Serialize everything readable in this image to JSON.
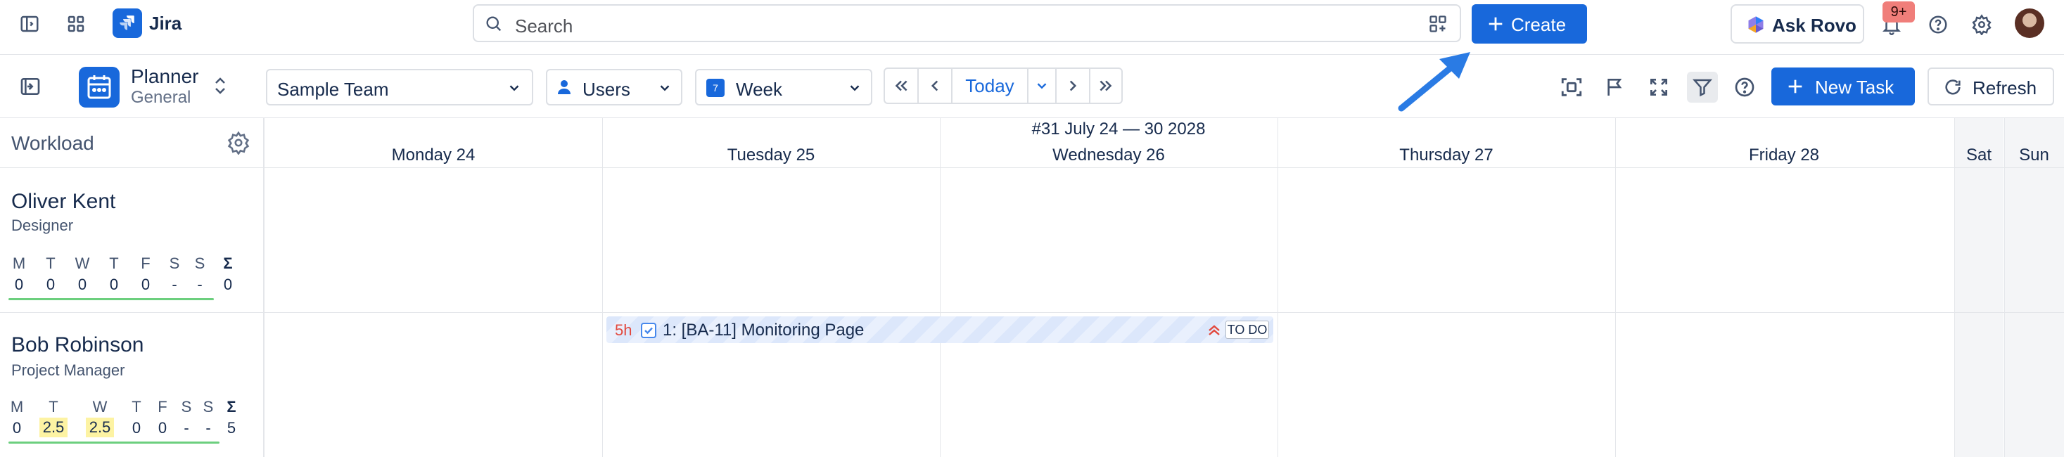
{
  "topbar": {
    "app_name": "Jira",
    "search_placeholder": "Search",
    "create_label": "Create",
    "ask_rovo_label": "Ask Rovo",
    "notifications_badge": "9+"
  },
  "toolbar": {
    "planner_title": "Planner",
    "planner_subtitle": "General",
    "team_select": "Sample Team",
    "users_select": "Users",
    "period_select": "Week",
    "period_icon_day": "7",
    "today_label": "Today",
    "new_task_label": "New Task",
    "refresh_label": "Refresh"
  },
  "grid": {
    "workload_label": "Workload",
    "week_label": "#31 July 24 — 30 2028",
    "days": [
      "Monday 24",
      "Tuesday 25",
      "Wednesday 26",
      "Thursday 27",
      "Friday 28",
      "Sat",
      "Sun"
    ]
  },
  "people": [
    {
      "name": "Oliver Kent",
      "role": "Designer",
      "day_letters": [
        "M",
        "T",
        "W",
        "T",
        "F",
        "S",
        "S"
      ],
      "sigma": "Σ",
      "values": [
        "0",
        "0",
        "0",
        "0",
        "0",
        "-",
        "-"
      ],
      "total": "0"
    },
    {
      "name": "Bob Robinson",
      "role": "Project Manager",
      "day_letters": [
        "M",
        "T",
        "W",
        "T",
        "F",
        "S",
        "S"
      ],
      "sigma": "Σ",
      "values": [
        "0",
        "2.5",
        "2.5",
        "0",
        "0",
        "-",
        "-"
      ],
      "total": "5"
    }
  ],
  "tasks": [
    {
      "hours": "5h",
      "title": "1: [BA-11] Monitoring Page",
      "status": "TO DO"
    }
  ],
  "colors": {
    "brand_blue": "#1868db",
    "hours_red": "#e2483d",
    "highlight_yellow": "#fdf3a3",
    "underline_green": "#6ccf7e",
    "annotation_arrow": "#2a7be4"
  },
  "icons": [
    "sidebar-toggle-icon",
    "app-switcher-icon",
    "jira-logo-icon",
    "search-icon",
    "search-filter-icon",
    "plus-icon",
    "rovo-icon",
    "bell-icon",
    "help-icon",
    "gear-icon",
    "calendar-icon",
    "chevron-up-down-icon",
    "chevron-down-icon",
    "user-icon",
    "double-chevron-left-icon",
    "chevron-left-icon",
    "chevron-right-icon",
    "double-chevron-right-icon",
    "screenshot-icon",
    "flag-icon",
    "fullscreen-icon",
    "filter-icon",
    "refresh-icon",
    "checkbox-icon",
    "priority-high-icon",
    "annotation-arrow"
  ]
}
